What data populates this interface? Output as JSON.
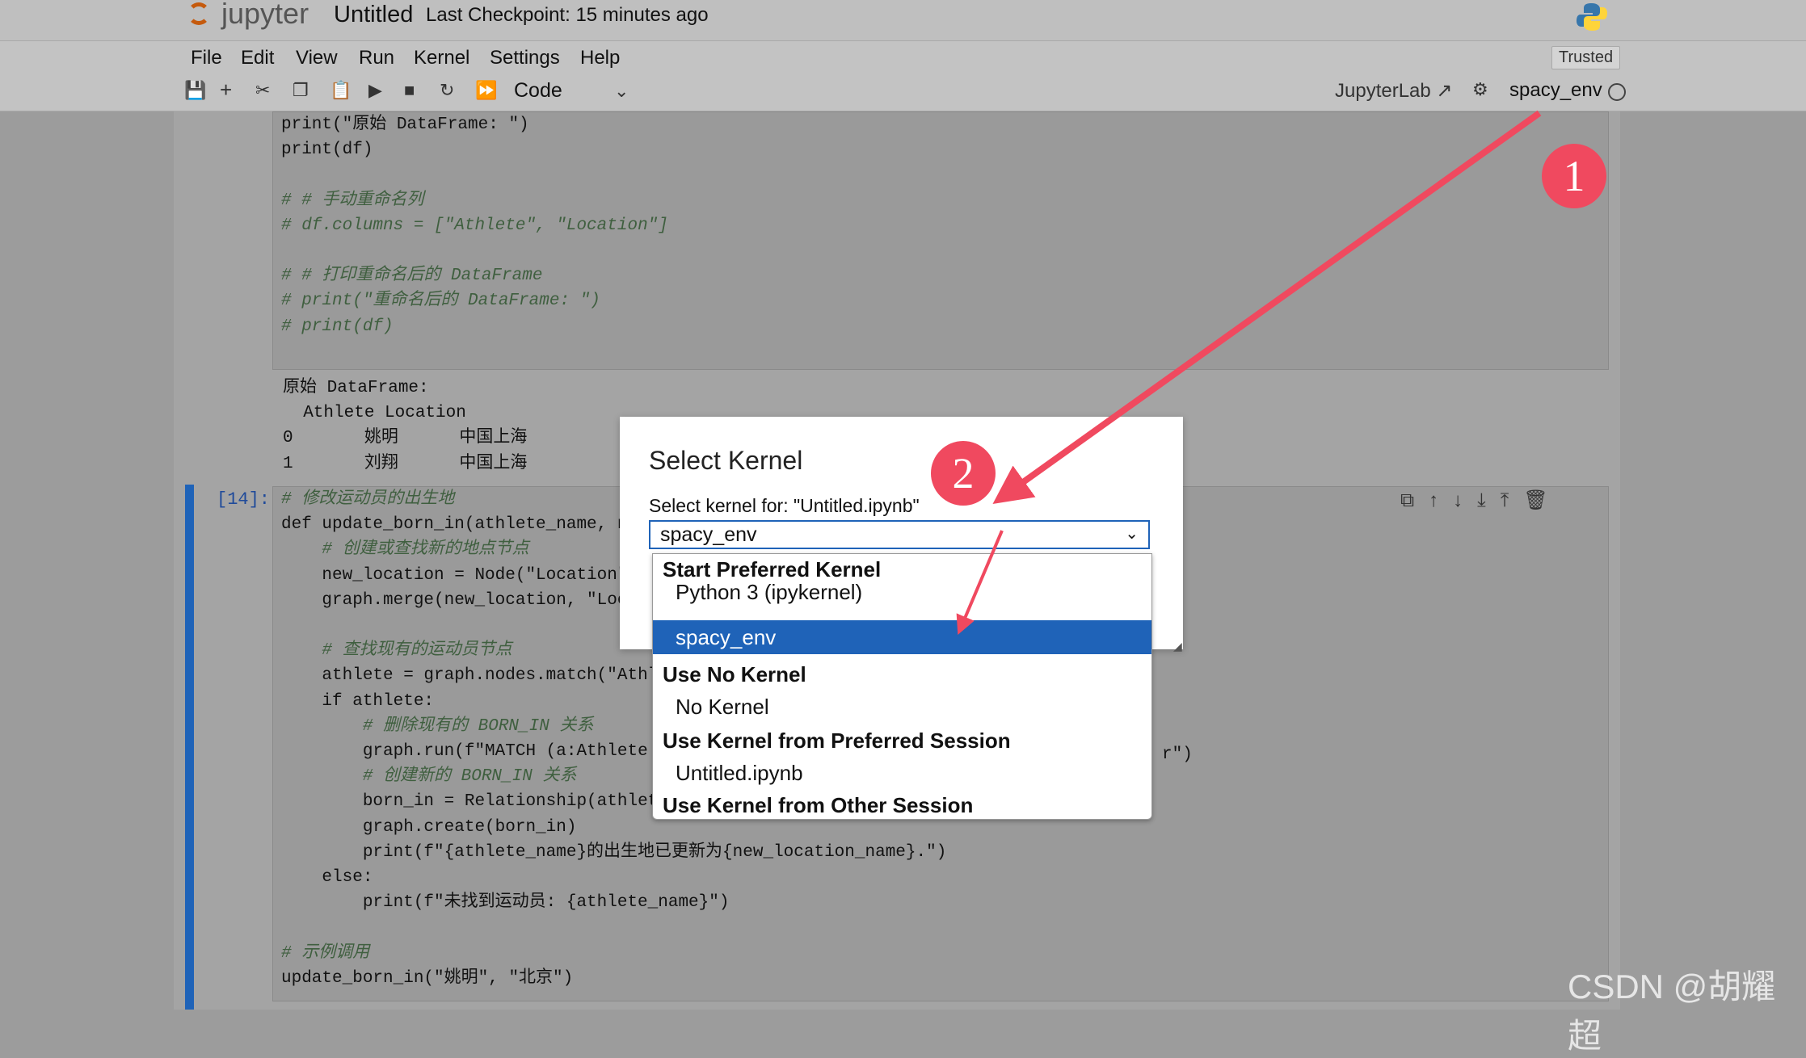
{
  "header": {
    "app_name": "jupyter",
    "notebook_title": "Untitled",
    "checkpoint": "Last Checkpoint: 15 minutes ago",
    "trusted": "Trusted"
  },
  "menu": [
    "File",
    "Edit",
    "View",
    "Run",
    "Kernel",
    "Settings",
    "Help"
  ],
  "toolbar": {
    "cell_type": "Code",
    "jupyterlab": "JupyterLab",
    "kernel_name": "spacy_env"
  },
  "cell1": {
    "code": [
      "print(\"原始 DataFrame: \")",
      "print(df)",
      "",
      "# # 手动重命名列",
      "# df.columns = [\"Athlete\", \"Location\"]",
      "",
      "# # 打印重命名后的 DataFrame",
      "# print(\"重命名后的 DataFrame: \")",
      "# print(df)"
    ]
  },
  "output1": [
    "原始 DataFrame:",
    "  Athlete Location",
    "0       姚明      中国上海",
    "1       刘翔      中国上海"
  ],
  "cell2": {
    "prompt": "[14]:",
    "code": [
      "# 修改运动员的出生地",
      "def update_born_in(athlete_name, n",
      "    # 创建或查找新的地点节点",
      "    new_location = Node(\"Location\"",
      "    graph.merge(new_location, \"Loc",
      "",
      "    # 查找现有的运动员节点",
      "    athlete = graph.nodes.match(\"Athl",
      "    if athlete:",
      "        # 删除现有的 BORN_IN 关系",
      "        graph.run(f\"MATCH (a:Athlete",
      "        # 创建新的 BORN_IN 关系",
      "        born_in = Relationship(athlet",
      "        graph.create(born_in)",
      "        print(f\"{athlete_name}的出生地已更新为{new_location_name}.\")",
      "    else:",
      "        print(f\"未找到运动员: {athlete_name}\")",
      "",
      "# 示例调用",
      "update_born_in(\"姚明\", \"北京\")"
    ],
    "overflow_text": "r\")"
  },
  "dialog": {
    "title": "Select Kernel",
    "label": "Select kernel for: \"Untitled.ipynb\"",
    "selected": "spacy_env"
  },
  "dropdown": {
    "groups": [
      {
        "label": "Start Preferred Kernel",
        "options": [
          "Python 3 (ipykernel)",
          "spacy_env"
        ]
      },
      {
        "label": "Use No Kernel",
        "options": [
          "No Kernel"
        ]
      },
      {
        "label": "Use Kernel from Preferred Session",
        "options": [
          "Untitled.ipynb"
        ]
      },
      {
        "label": "Use Kernel from Other Session",
        "options": []
      }
    ]
  },
  "annotations": {
    "badge1": "1",
    "badge2": "2"
  },
  "watermark": "CSDN @胡耀超",
  "colors": {
    "accent": "#1f63b8",
    "badge": "#f0495f",
    "arrow": "#f0495f"
  }
}
